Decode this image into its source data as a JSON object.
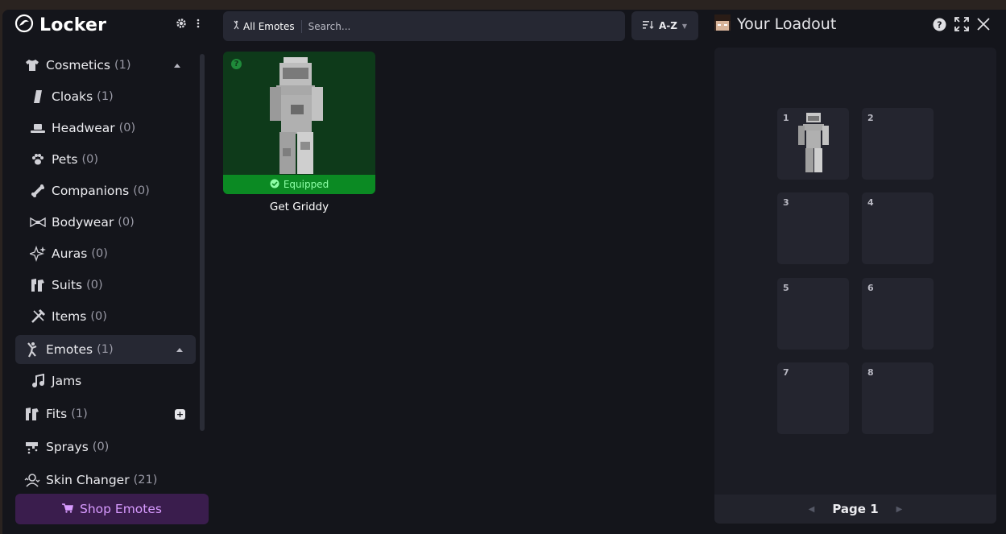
{
  "sidebar": {
    "brand": "Locker",
    "items": [
      {
        "label": "Cosmetics",
        "count": "(1)"
      },
      {
        "label": "Cloaks",
        "count": "(1)"
      },
      {
        "label": "Headwear",
        "count": "(0)"
      },
      {
        "label": "Pets",
        "count": "(0)"
      },
      {
        "label": "Companions",
        "count": "(0)"
      },
      {
        "label": "Bodywear",
        "count": "(0)"
      },
      {
        "label": "Auras",
        "count": "(0)"
      },
      {
        "label": "Suits",
        "count": "(0)"
      },
      {
        "label": "Items",
        "count": "(0)"
      },
      {
        "label": "Emotes",
        "count": "(1)"
      },
      {
        "label": "Jams",
        "count": ""
      },
      {
        "label": "Fits",
        "count": "(1)"
      },
      {
        "label": "Sprays",
        "count": "(0)"
      },
      {
        "label": "Skin Changer",
        "count": "(21)"
      }
    ],
    "shop_label": "Shop Emotes"
  },
  "toolbar": {
    "filter_label": "All Emotes",
    "search_placeholder": "Search...",
    "sort_label": "A-Z"
  },
  "grid": {
    "items": [
      {
        "title": "Get Griddy",
        "status": "Equipped"
      }
    ]
  },
  "loadout": {
    "title": "Your Loadout",
    "slots": [
      "1",
      "2",
      "3",
      "4",
      "5",
      "6",
      "7",
      "8"
    ],
    "page_label": "Page 1"
  },
  "colors": {
    "accent_purple": "#d89bff",
    "equipped_green": "#0b8a23",
    "background": "#14151b"
  }
}
